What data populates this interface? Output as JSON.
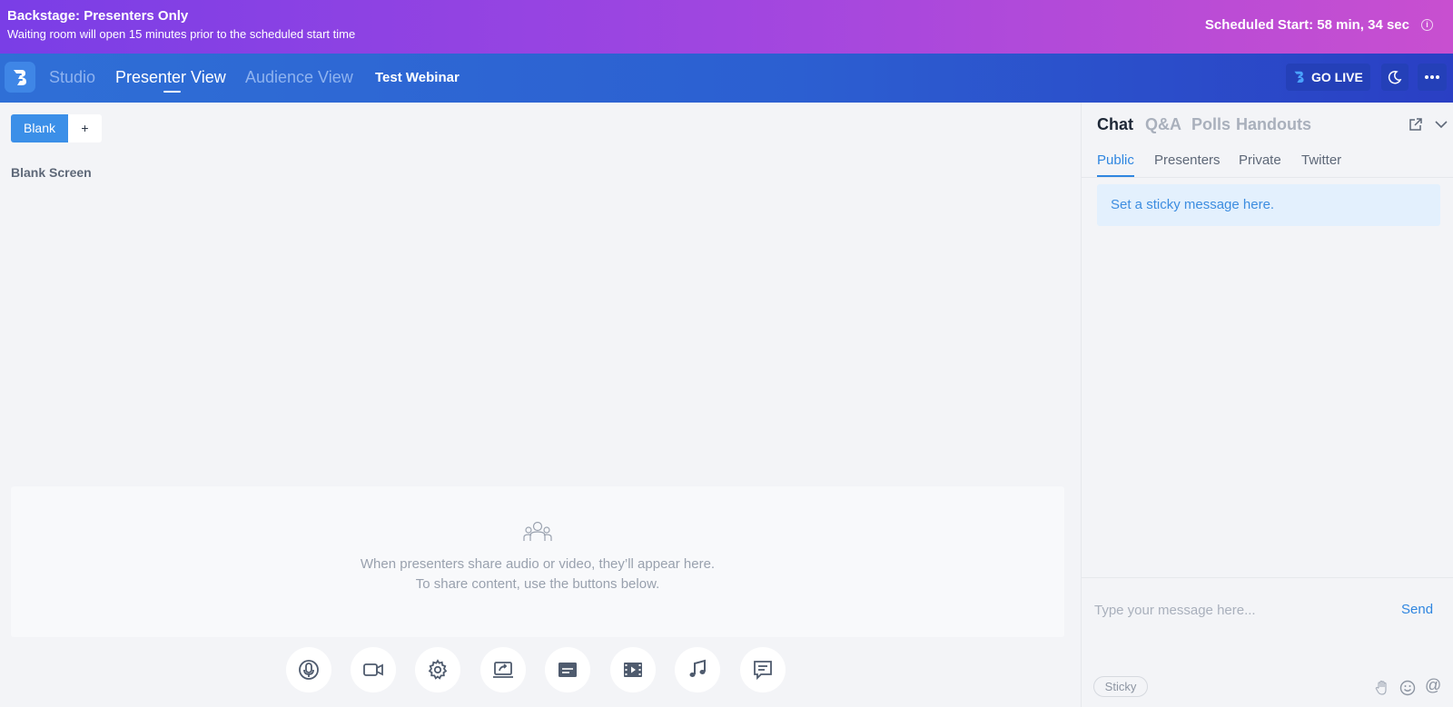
{
  "banner": {
    "title": "Backstage: Presenters Only",
    "subtitle": "Waiting room will open 15 minutes prior to the scheduled start time",
    "scheduled": "Scheduled Start: 58 min, 34 sec",
    "info_glyph": "i"
  },
  "nav": {
    "items": [
      {
        "label": "Studio",
        "active": false
      },
      {
        "label": "Presenter View",
        "active": true
      },
      {
        "label": "Audience View",
        "active": false
      }
    ],
    "webinar_title": "Test Webinar",
    "go_live_label": "GO LIVE"
  },
  "scenes": {
    "tabs": [
      {
        "label": "Blank"
      },
      {
        "label": "+"
      }
    ],
    "current_scene_label": "Blank Screen"
  },
  "stage": {
    "line1": "When presenters share audio or video, they’ll appear here.",
    "line2": "To share content, use the buttons below."
  },
  "toolbar": {
    "buttons": [
      "microphone-icon",
      "camera-icon",
      "settings-gear-icon",
      "screen-share-icon",
      "slides-icon",
      "video-icon",
      "music-icon",
      "chat-overlay-icon"
    ]
  },
  "panel": {
    "tabs": [
      {
        "label": "Chat",
        "active": true
      },
      {
        "label": "Q&A",
        "active": false
      },
      {
        "label": "Polls",
        "active": false
      },
      {
        "label": "Handouts",
        "active": false
      }
    ],
    "subtabs": [
      {
        "label": "Public",
        "active": true
      },
      {
        "label": "Presenters",
        "active": false
      },
      {
        "label": "Private",
        "active": false
      },
      {
        "label": "Twitter",
        "active": false
      }
    ],
    "sticky_placeholder": "Set a sticky message here.",
    "input_placeholder": "Type your message here...",
    "send_label": "Send",
    "sticky_pill": "Sticky",
    "at_glyph": "@"
  },
  "colors": {
    "banner_gradient_start": "#7a3ee6",
    "banner_gradient_end": "#c84fd0",
    "nav_blue": "#2c5fd1",
    "accent_blue": "#3b8fe8",
    "link_blue": "#2f86e0"
  }
}
